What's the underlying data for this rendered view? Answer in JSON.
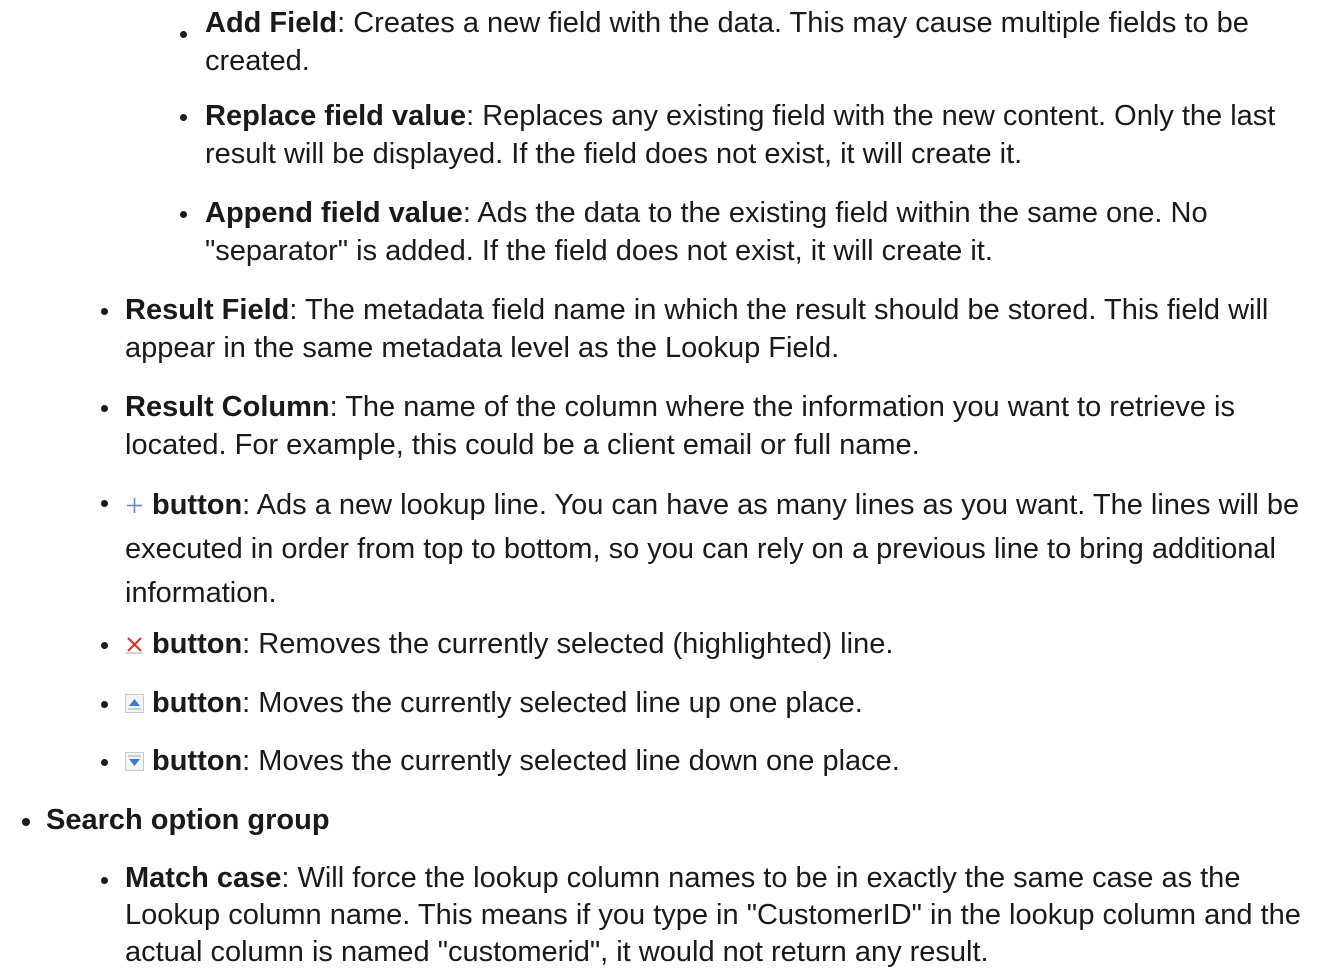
{
  "items": {
    "add_field": {
      "term": "Add Field",
      "text": ": Creates a new field with the data. This may cause multiple fields to be created."
    },
    "replace_field_value": {
      "term": "Replace field value",
      "text": ": Replaces any existing field with the new content. Only the last result will be displayed. If the field does not exist, it will create it."
    },
    "append_field_value": {
      "term": "Append field value",
      "text": ": Ads the data to the existing field within the same one. No \"separator\" is added. If the field does not exist, it will create it."
    },
    "result_field": {
      "term": "Result Field",
      "text": ": The metadata field name in which the result should be stored. This field will appear in the same metadata level as the Lookup Field."
    },
    "result_column": {
      "term": "Result Column",
      "text": ": The name of the column where the information you want to retrieve is located. For example, this could be a client email or full name."
    },
    "add_button": {
      "icon": "plus-icon",
      "term": "button",
      "text": ": Ads a new lookup line. You can have as many lines as you want. The lines will be executed in order from top to bottom, so you can rely on a previous line to bring additional information."
    },
    "remove_button": {
      "icon": "red-x-icon",
      "term": "button",
      "text": ": Removes the currently selected (highlighted) line."
    },
    "up_button": {
      "icon": "arrow-up-icon",
      "term": "button",
      "text": ": Moves the currently selected line up one place."
    },
    "down_button": {
      "icon": "arrow-down-icon",
      "term": "button",
      "text": ": Moves the currently selected line down one place."
    },
    "search_option_group": {
      "term": "Search option group"
    },
    "match_case": {
      "term": "Match case",
      "text": ": Will force the lookup column names to be in exactly the same case as the Lookup column name. This means if you type in \"CustomerID\" in the lookup column and the actual column is named \"customerid\", it would not return any result."
    }
  },
  "colors": {
    "text": "#1a1a1a",
    "delete_icon": "#d83a2a",
    "arrow_icon": "#3b7ac8"
  }
}
